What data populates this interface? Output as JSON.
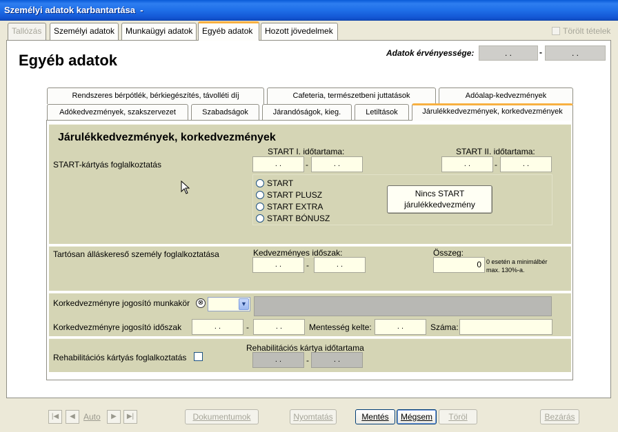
{
  "window": {
    "title": "Személyi adatok karbantartása  -"
  },
  "tabs": [
    {
      "label": "Tallózás",
      "state": "disabled"
    },
    {
      "label": "Személyi adatok",
      "state": "normal"
    },
    {
      "label": "Munkaügyi adatok",
      "state": "normal"
    },
    {
      "label": "Egyéb adatok",
      "state": "active"
    },
    {
      "label": "Hozott jövedelmek",
      "state": "normal"
    }
  ],
  "deleted_items_label": "Törölt tételek",
  "page_title": "Egyéb adatok",
  "validity": {
    "label": "Adatok érvényessége:",
    "from": ". .",
    "to": ". .",
    "separator": "-"
  },
  "subtabs_row1": [
    "Rendszeres bérpótlék, bérkiegészítés, távolléti díj",
    "Cafeteria, természetbeni juttatások",
    "Adóalap-kedvezmények"
  ],
  "subtabs_row2": [
    "Adókedvezmények, szakszervezet",
    "Szabadságok",
    "Járandóságok, kieg.",
    "Letiltások",
    "Járulékkedvezmények, korkedvezmények"
  ],
  "section_title": "Járulékkedvezmények, korkedvezmények",
  "start": {
    "label": "START-kártyás foglalkoztatás",
    "period1_label": "START I. időtartama:",
    "period1_from": ". .",
    "period1_to": ". .",
    "period2_label": "START II. időtartama:",
    "period2_from": ". .",
    "period2_to": ". .",
    "options": [
      "START",
      "START PLUSZ",
      "START EXTRA",
      "START BÓNUSZ"
    ],
    "none_button": [
      "Nincs START",
      "járulékkedvezmény"
    ]
  },
  "jobseeker": {
    "label": "Tartósan álláskereső személy foglalkoztatása",
    "period_label": "Kedvezményes időszak:",
    "from": ". .",
    "to": ". .",
    "amount_label": "Összeg:",
    "amount": "0",
    "note": [
      "0 esetén a minimálbér",
      "max. 130%-a."
    ]
  },
  "early_retirement": {
    "job_label": "Korkedvezményre jogosító munkakör",
    "period_label": "Korkedvezményre jogosító időszak",
    "from": ". .",
    "to": ". .",
    "exemption_label": "Mentesség kelte:",
    "exemption_date": ". .",
    "number_label": "Száma:"
  },
  "rehab": {
    "label": "Rehabilitációs kártyás foglalkoztatás",
    "period_label": "Rehabilitációs kártya időtartama",
    "from": ". .",
    "to": ". ."
  },
  "dash": "-",
  "toolbar": {
    "auto_label": "Auto",
    "documents": "Dokumentumok",
    "print": "Nyomtatás",
    "save": "Mentés",
    "cancel": "Mégsem",
    "delete": "Töröl",
    "close": "Bezárás"
  },
  "colors": {
    "titlebar": "#1F6FE8",
    "section_bg": "#D5D5B5",
    "tab_accent": "#F7B040",
    "field_bg": "#FFFFE8"
  }
}
